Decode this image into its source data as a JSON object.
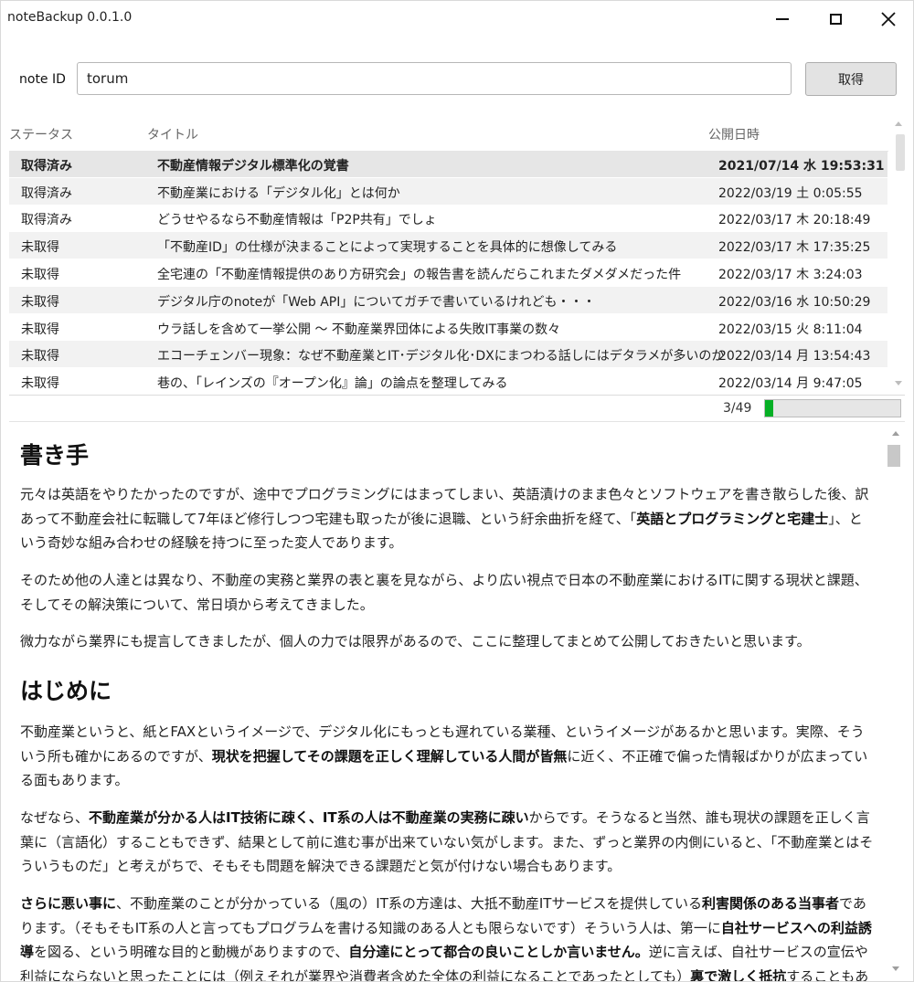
{
  "window": {
    "title": "noteBackup 0.0.1.0"
  },
  "form": {
    "label": "note ID",
    "value": "torum",
    "fetch_button": "取得"
  },
  "list": {
    "columns": {
      "status": "ステータス",
      "title": "タイトル",
      "date": "公開日時"
    },
    "rows": [
      {
        "status": "取得済み",
        "title": "不動産情報デジタル標準化の覚書",
        "date": "2021/07/14 水 19:53:31"
      },
      {
        "status": "取得済み",
        "title": "不動産業における「デジタル化」とは何か",
        "date": "2022/03/19 土 0:05:55"
      },
      {
        "status": "取得済み",
        "title": "どうせやるなら不動産情報は「P2P共有」でしょ",
        "date": "2022/03/17 木 20:18:49"
      },
      {
        "status": "未取得",
        "title": "「不動産ID」の仕様が決まることによって実現することを具体的に想像してみる",
        "date": "2022/03/17 木 17:35:25"
      },
      {
        "status": "未取得",
        "title": "全宅連の「不動産情報提供のあり方研究会」の報告書を読んだらこれまたダメダメだった件",
        "date": "2022/03/17 木 3:24:03"
      },
      {
        "status": "未取得",
        "title": "デジタル庁のnoteが「Web API」についてガチで書いているけれども・・・",
        "date": "2022/03/16 水 10:50:29"
      },
      {
        "status": "未取得",
        "title": "ウラ話しを含めて一挙公開 〜 不動産業界団体による失敗IT事業の数々",
        "date": "2022/03/15 火 8:11:04"
      },
      {
        "status": "未取得",
        "title": "エコーチェンバー現象：なぜ不動産業とIT･デジタル化･DXにまつわる話しにはデタラメが多いのか",
        "date": "2022/03/14 月 13:54:43"
      },
      {
        "status": "未取得",
        "title": "巷の、「レインズの『オープン化』論」の論点を整理してみる",
        "date": "2022/03/14 月 9:47:05"
      }
    ]
  },
  "progress": {
    "text": "3/49",
    "value": 0.061,
    "color": "#06b025"
  },
  "document": {
    "h1": "書き手",
    "p1": [
      {
        "t": "元々は英語をやりたかったのですが、途中でプログラミングにはまってしまい、英語漬けのまま色々とソフトウェアを書き散らした後、訳あって不動産会社に転職して7年ほど修行しつつ宅建も取ったが後に退職、という紆余曲折を経て、「"
      },
      {
        "t": "英語とプログラミングと宅建士",
        "b": true
      },
      {
        "t": "」、という奇妙な組み合わせの経験を持つに至った変人であります。"
      }
    ],
    "p2": [
      {
        "t": "そのため他の人達とは異なり、不動産の実務と業界の表と裏を見ながら、より広い視点で日本の不動産業におけるITに関する現状と課題、そしてその解決策について、常日頃から考えてきました。"
      }
    ],
    "p3": [
      {
        "t": "微力ながら業界にも提言してきましたが、個人の力では限界があるので、ここに整理してまとめて公開しておきたいと思います。"
      }
    ],
    "h2": "はじめに",
    "p4": [
      {
        "t": "不動産業というと、紙とFAXというイメージで、デジタル化にもっとも遅れている業種、というイメージがあるかと思います。実際、そういう所も確かにあるのですが、"
      },
      {
        "t": "現状を把握してその課題を正しく理解している人間が皆無",
        "b": true
      },
      {
        "t": "に近く、不正確で偏った情報ばかりが広まっている面もあります。"
      }
    ],
    "p5": [
      {
        "t": "なぜなら、"
      },
      {
        "t": "不動産業が分かる人はIT技術に疎く、IT系の人は不動産業の実務に疎い",
        "b": true
      },
      {
        "t": "からです。そうなると当然、誰も現状の課題を正しく言葉に（言語化）することもできず、結果として前に進む事が出来ていない気がします。また、ずっと業界の内側にいると、「不動産業とはそういうものだ」と考えがちで、そもそも問題を解決できる課題だと気が付けない場合もあります。"
      }
    ],
    "p6": [
      {
        "t": "さらに悪い事に",
        "b": true
      },
      {
        "t": "、不動産業のことが分かっている（風の）IT系の方達は、大抵不動産ITサービスを提供している"
      },
      {
        "t": "利害関係のある当事者",
        "b": true
      },
      {
        "t": "であります。（そもそもIT系の人と言ってもプログラムを書ける知識のある人とも限らないです）そういう人は、第一に"
      },
      {
        "t": "自社サービスへの利益誘導",
        "b": true
      },
      {
        "t": "を図る、という明確な目的と動機がありますので、"
      },
      {
        "t": "自分達にとって都合の良いことしか言いません。",
        "b": true
      },
      {
        "t": "逆に言えば、自社サービスの宣伝や利益にならないと思ったことには（例えそれが業界や消費者含めた全体の利益になることであったとしても）"
      },
      {
        "t": "裏で激しく抵抗",
        "b": true
      },
      {
        "t": "することもあります。"
      }
    ]
  }
}
